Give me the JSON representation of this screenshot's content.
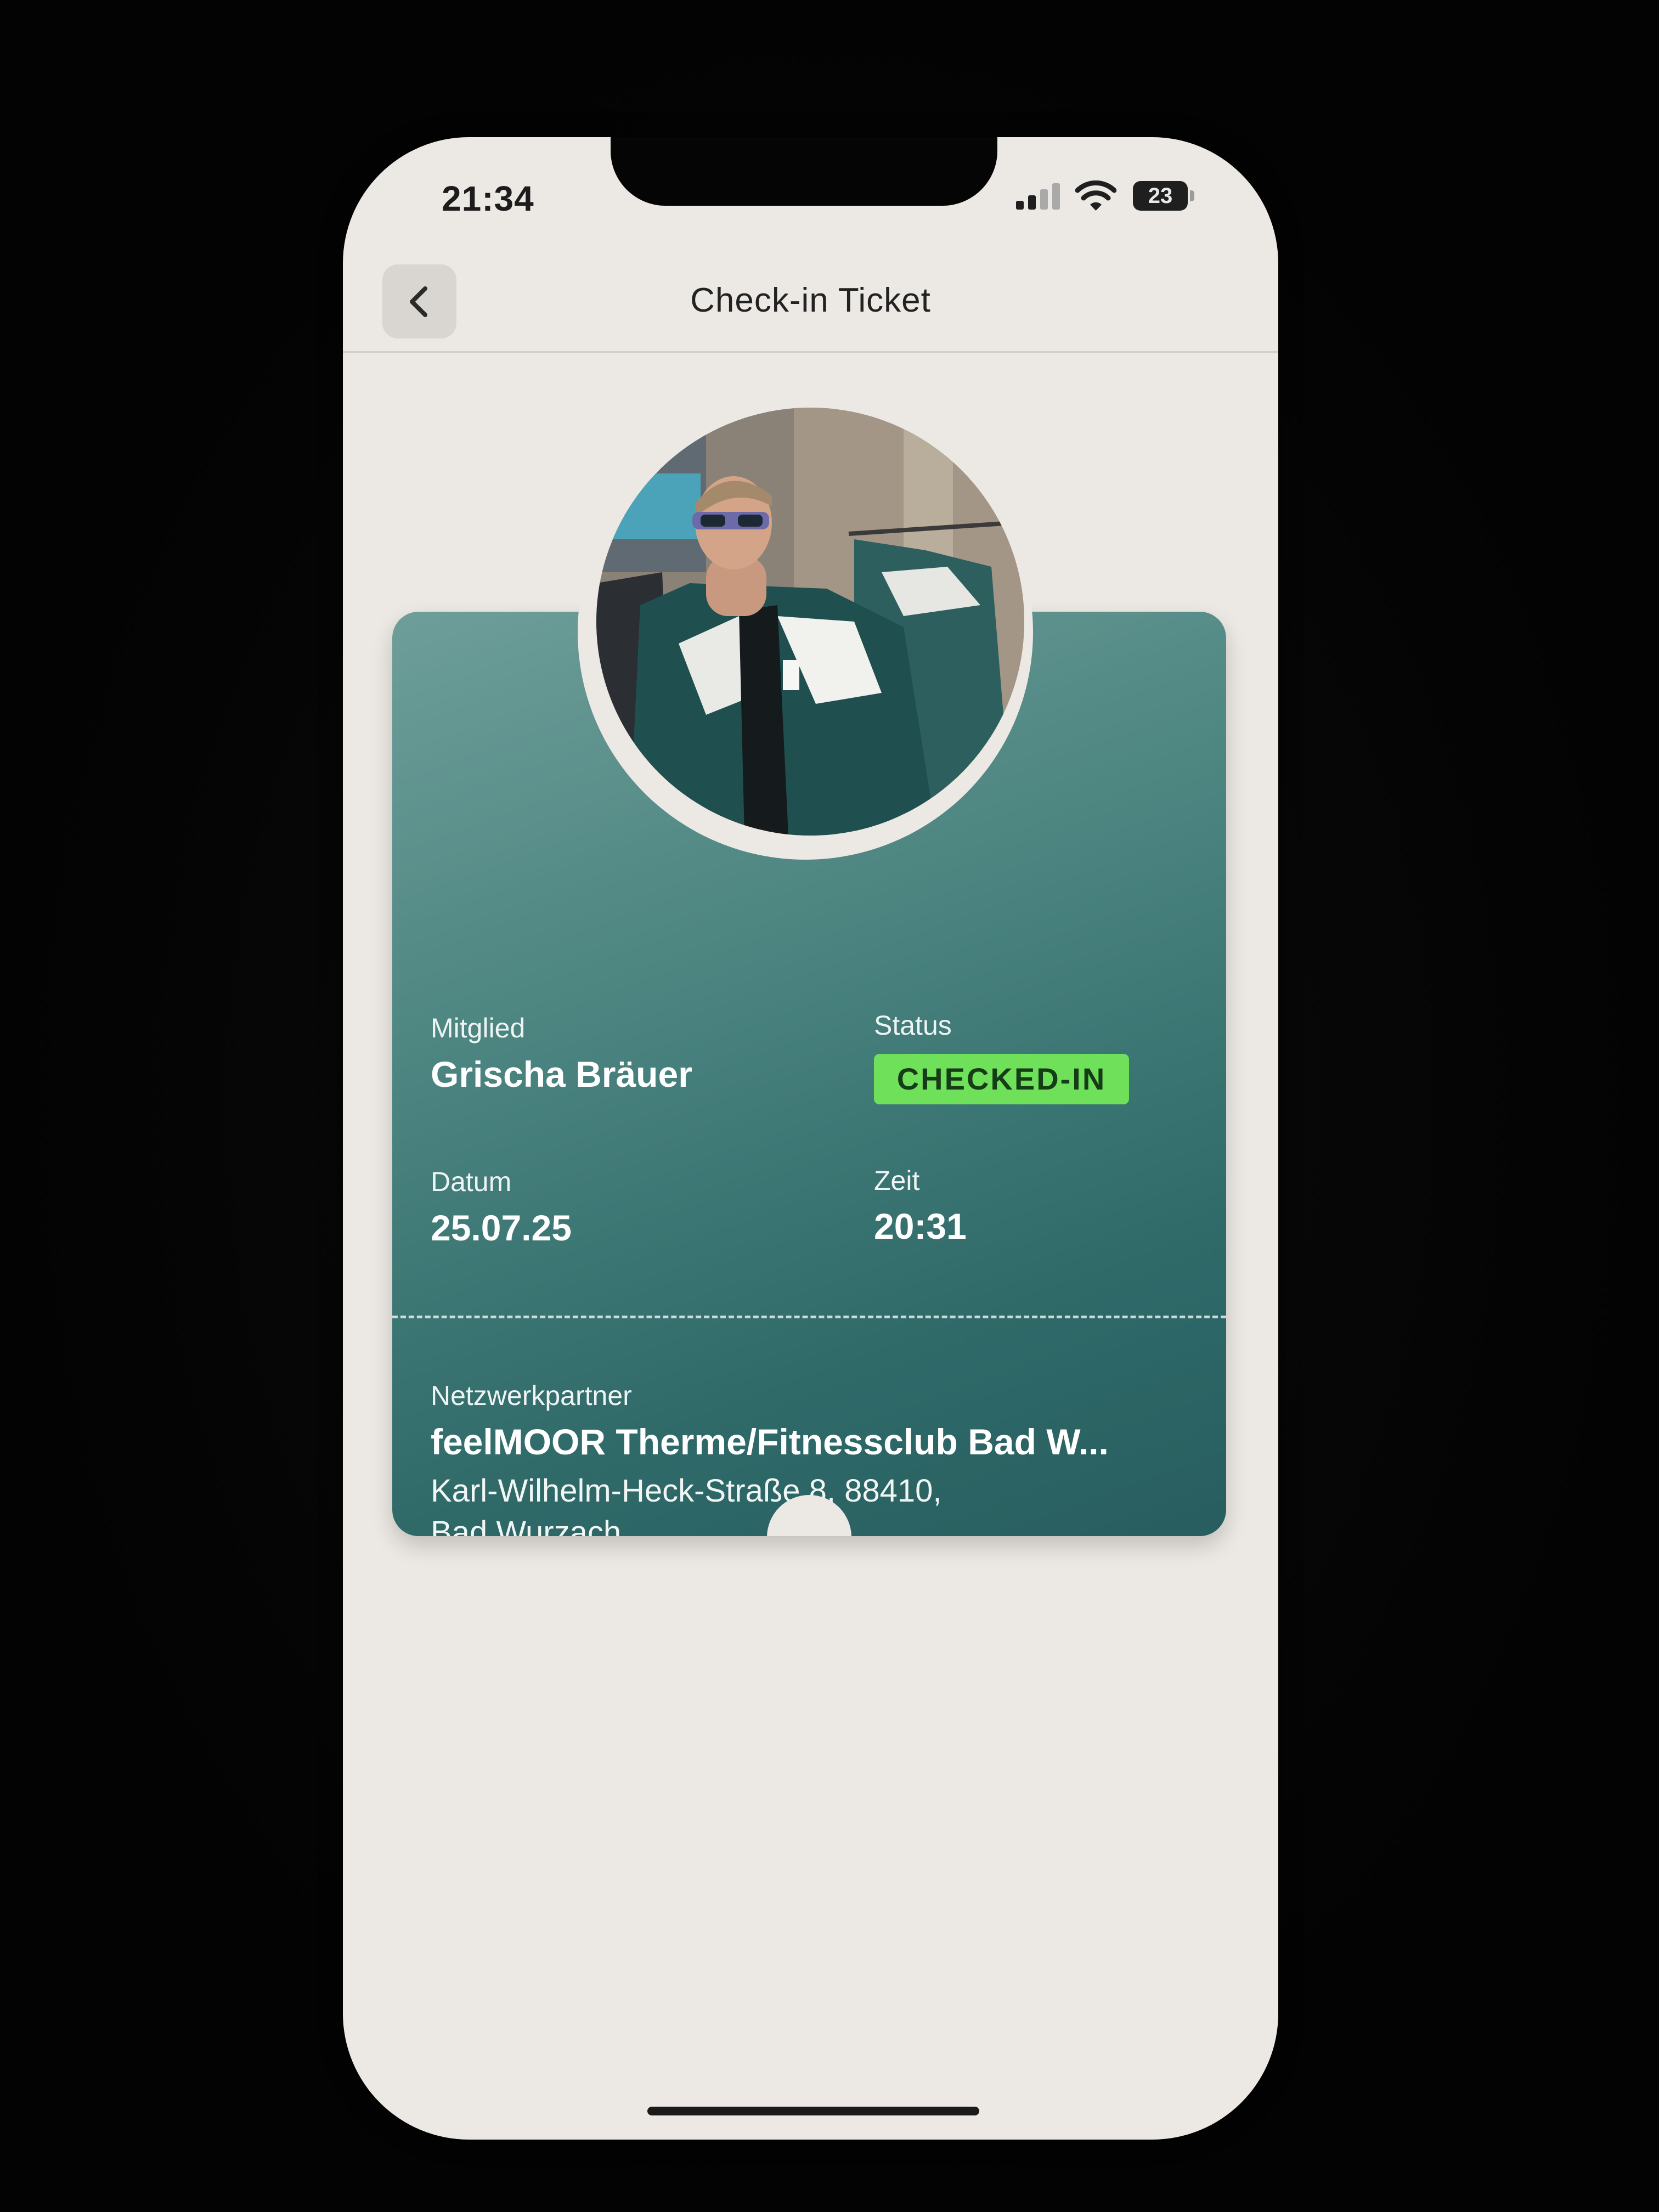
{
  "status_bar": {
    "time": "21:34",
    "battery_level": "23",
    "signal_icon": "cellular-signal-icon",
    "wifi_icon": "wifi-icon"
  },
  "nav": {
    "title": "Check-in Ticket",
    "back_icon": "chevron-left-icon"
  },
  "ticket": {
    "member_label": "Mitglied",
    "member_name": "Grischa Bräuer",
    "status_label": "Status",
    "status_value": "CHECKED-IN",
    "date_label": "Datum",
    "date_value": "25.07.25",
    "time_label": "Zeit",
    "time_value": "20:31",
    "partner_label": "Netzwerkpartner",
    "partner_name": "feelMOOR Therme/Fitnessclub Bad W...",
    "address_line1": "Karl-Wilhelm-Heck-Straße 8, 88410,",
    "address_line2": "Bad Wurzach"
  },
  "colors": {
    "ticket_gradient_start": "#6e9e99",
    "ticket_gradient_end": "#285d5f",
    "status_badge": "#6fe05a",
    "screen_background": "#ece9e4"
  }
}
